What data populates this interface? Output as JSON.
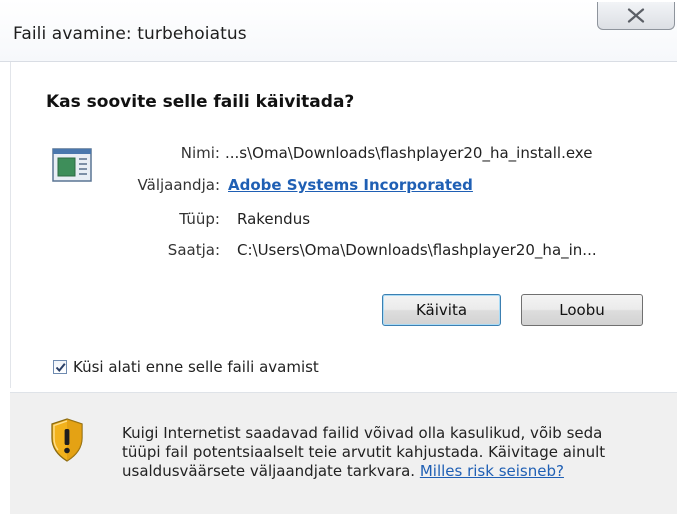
{
  "window": {
    "title": "Faili avamine: turbehoiatus",
    "close_icon": "close-x-icon"
  },
  "prompt": {
    "question": "Kas soovite selle faili käivitada?"
  },
  "file_info": {
    "icon": "executable-file-icon",
    "name_label": "Nimi:",
    "name_value": "...s\\Oma\\Downloads\\flashplayer20_ha_install.exe",
    "publisher_label": "Väljaandja:",
    "publisher_value": "Adobe Systems Incorporated",
    "type_label": "Tüüp:",
    "type_value": "Rakendus",
    "from_label": "Saatja:",
    "from_value": "C:\\Users\\Oma\\Downloads\\flashplayer20_ha_in..."
  },
  "buttons": {
    "run_label": "Käivita",
    "cancel_label": "Loobu"
  },
  "checkbox": {
    "label": "Küsi alati enne selle faili avamist",
    "checked": true
  },
  "warning": {
    "icon": "security-shield-icon",
    "text": "Kuigi Internetist saadavad failid võivad olla kasulikud, võib seda tüüpi fail potentsiaalselt teie arvutit kahjustada. Käivitage ainult usaldusväärsete väljaandjate tarkvara.",
    "link_label": "Milles risk seisneb?"
  },
  "colors": {
    "link": "#1f5fb4",
    "warning_panel": "#f0f0f0",
    "shield_yellow": "#f2b21c"
  }
}
